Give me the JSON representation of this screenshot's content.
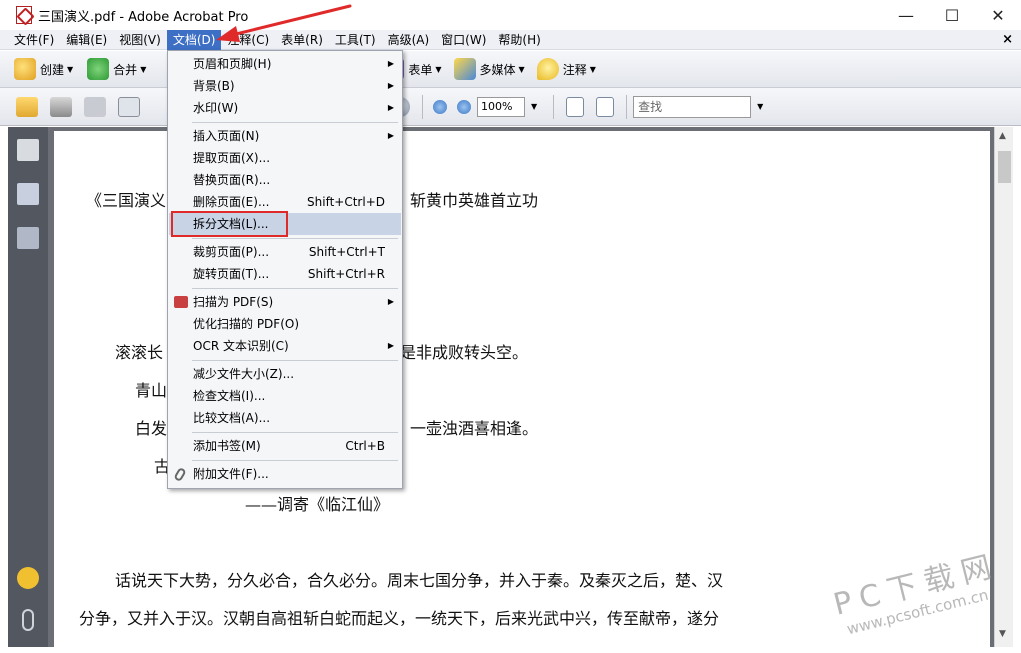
{
  "window": {
    "title": "三国演义.pdf - Adobe Acrobat Pro",
    "minimize": "—",
    "maximize": "☐",
    "close": "✕"
  },
  "menubar": {
    "items": [
      "文件(F)",
      "编辑(E)",
      "视图(V)",
      "文档(D)",
      "注释(C)",
      "表单(R)",
      "工具(T)",
      "高级(A)",
      "窗口(W)",
      "帮助(H)"
    ],
    "active": "文档(D)",
    "close_glyph": "×"
  },
  "toolbar1": {
    "create": "创建",
    "merge": "合并",
    "forms": "表单",
    "multimedia": "多媒体",
    "comment": "注释"
  },
  "toolbar2": {
    "zoom": "100%",
    "find_placeholder": "查找"
  },
  "document_menu": {
    "items": [
      {
        "label": "页眉和页脚(H)",
        "shortcut": "",
        "submenu": true
      },
      {
        "label": "背景(B)",
        "shortcut": "",
        "submenu": true
      },
      {
        "label": "水印(W)",
        "shortcut": "",
        "submenu": true
      },
      {
        "label": "插入页面(N)",
        "shortcut": "",
        "submenu": true
      },
      {
        "label": "提取页面(X)...",
        "shortcut": "",
        "submenu": false
      },
      {
        "label": "替换页面(R)...",
        "shortcut": "",
        "submenu": false
      },
      {
        "label": "删除页面(E)...",
        "shortcut": "Shift+Ctrl+D",
        "submenu": false
      },
      {
        "label": "拆分文档(L)...",
        "shortcut": "",
        "submenu": false,
        "highlighted": true
      },
      {
        "label": "裁剪页面(P)...",
        "shortcut": "Shift+Ctrl+T",
        "submenu": false
      },
      {
        "label": "旋转页面(T)...",
        "shortcut": "Shift+Ctrl+R",
        "submenu": false
      },
      {
        "label": "扫描为 PDF(S)",
        "shortcut": "",
        "submenu": true
      },
      {
        "label": "优化扫描的 PDF(O)",
        "shortcut": "",
        "submenu": false
      },
      {
        "label": "OCR 文本识别(C)",
        "shortcut": "",
        "submenu": true
      },
      {
        "label": "减少文件大小(Z)...",
        "shortcut": "",
        "submenu": false
      },
      {
        "label": "检查文档(I)...",
        "shortcut": "",
        "submenu": false
      },
      {
        "label": "比较文档(A)...",
        "shortcut": "",
        "submenu": false
      },
      {
        "label": "添加书签(M)",
        "shortcut": "Ctrl+B",
        "submenu": false
      },
      {
        "label": "附加文件(F)...",
        "shortcut": "",
        "submenu": false
      }
    ]
  },
  "document": {
    "lines": [
      "《三国演义",
      "斩黄巾英雄首立功",
      "滚滚长",
      "是非成败转头空。",
      "青山",
      "白发",
      "一壶浊酒喜相逢。",
      "古",
      "——调寄《临江仙》",
      "话说天下大势，分久必合，合久必分。周末七国分争，并入于秦。及秦灭之后，楚、汉",
      "分争，又并入于汉。汉朝自高祖斩白蛇而起义，一统天下，后来光武中兴，传至献帝，遂分"
    ]
  },
  "watermark": {
    "brand": "PC下载网",
    "url": "www.pcsoft.com.cn"
  }
}
